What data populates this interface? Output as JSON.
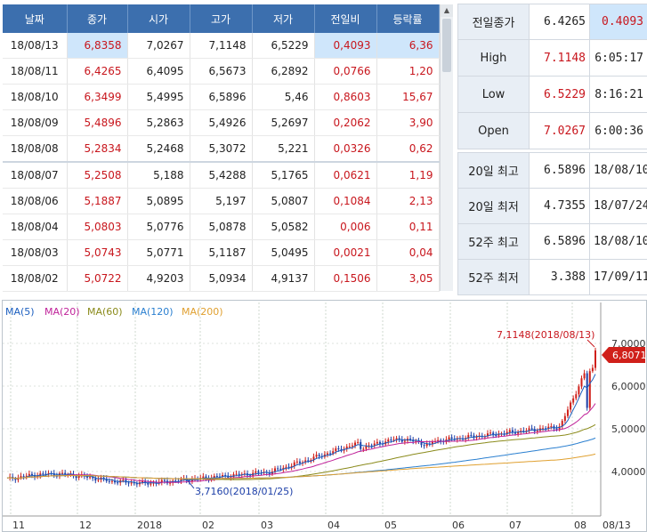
{
  "daily": {
    "columns": [
      "날짜",
      "종가",
      "시가",
      "고가",
      "저가",
      "전일비",
      "등락률"
    ],
    "rows": [
      {
        "date": "18/08/13",
        "close": "6,8358",
        "open": "7,0267",
        "high": "7,1148",
        "low": "6,5229",
        "change": "0,4093",
        "rate": "6,36"
      },
      {
        "date": "18/08/11",
        "close": "6,4265",
        "open": "6,4095",
        "high": "6,5673",
        "low": "6,2892",
        "change": "0,0766",
        "rate": "1,20"
      },
      {
        "date": "18/08/10",
        "close": "6,3499",
        "open": "5,4995",
        "high": "6,5896",
        "low": "5,46",
        "change": "0,8603",
        "rate": "15,67"
      },
      {
        "date": "18/08/09",
        "close": "5,4896",
        "open": "5,2863",
        "high": "5,4926",
        "low": "5,2697",
        "change": "0,2062",
        "rate": "3,90"
      },
      {
        "date": "18/08/08",
        "close": "5,2834",
        "open": "5,2468",
        "high": "5,3072",
        "low": "5,221",
        "change": "0,0326",
        "rate": "0,62"
      },
      {
        "date": "18/08/07",
        "close": "5,2508",
        "open": "5,188",
        "high": "5,4288",
        "low": "5,1765",
        "change": "0,0621",
        "rate": "1,19"
      },
      {
        "date": "18/08/06",
        "close": "5,1887",
        "open": "5,0895",
        "high": "5,197",
        "low": "5,0807",
        "change": "0,1084",
        "rate": "2,13"
      },
      {
        "date": "18/08/04",
        "close": "5,0803",
        "open": "5,0776",
        "high": "5,0878",
        "low": "5,0582",
        "change": "0,006",
        "rate": "0,11"
      },
      {
        "date": "18/08/03",
        "close": "5,0743",
        "open": "5,0771",
        "high": "5,1187",
        "low": "5,0495",
        "change": "0,0021",
        "rate": "0,04"
      },
      {
        "date": "18/08/02",
        "close": "5,0722",
        "open": "4,9203",
        "high": "5,0934",
        "low": "4,9137",
        "change": "0,1506",
        "rate": "3,05"
      }
    ]
  },
  "scrollbar": {
    "up_arrow": "▲"
  },
  "summary": {
    "prev_close": {
      "label": "전일종가",
      "value": "6.4265",
      "change": "0.4093"
    },
    "high": {
      "label": "High",
      "value": "7.1148",
      "time": "6:05:17"
    },
    "low": {
      "label": "Low",
      "value": "6.5229",
      "time": "8:16:21"
    },
    "open": {
      "label": "Open",
      "value": "7.0267",
      "time": "6:00:36"
    }
  },
  "range": [
    {
      "label": "20일 최고",
      "value": "6.5896",
      "date": "18/08/10"
    },
    {
      "label": "20일 최저",
      "value": "4.7355",
      "date": "18/07/24"
    },
    {
      "label": "52주 최고",
      "value": "6.5896",
      "date": "18/08/10"
    },
    {
      "label": "52주 최저",
      "value": "3.388",
      "date": "17/09/11"
    }
  ],
  "chart": {
    "legend": [
      {
        "label": "MA(5)",
        "color": "#1c5fbf"
      },
      {
        "label": "MA(20)",
        "color": "#c0239a"
      },
      {
        "label": "MA(60)",
        "color": "#8a8a1a"
      },
      {
        "label": "MA(120)",
        "color": "#2a7fd0"
      },
      {
        "label": "MA(200)",
        "color": "#e0a030"
      }
    ],
    "max_annotation": "7,1148(2018/08/13)",
    "min_annotation": "3,7160(2018/01/25)",
    "current_price": "6,8071",
    "current_color": "#d0201a",
    "y_ticks": [
      "7,0000",
      "6,0000",
      "5,0000",
      "4,0000"
    ],
    "x_ticks": [
      "11",
      "12",
      "2018",
      "02",
      "03",
      "04",
      "05",
      "06",
      "07",
      "08",
      "08/13"
    ]
  },
  "chart_data": {
    "type": "candlestick",
    "y_ticks": [
      7.0,
      6.0,
      5.0,
      4.0
    ],
    "ylim": [
      3.0,
      7.8
    ],
    "x_ticks": [
      "11",
      "12",
      "2018",
      "02",
      "03",
      "04",
      "05",
      "06",
      "07",
      "08",
      "08/13"
    ],
    "approx_close_by_month": {
      "11": 3.8,
      "12": 3.9,
      "2018": 3.8,
      "02": 3.75,
      "03": 3.8,
      "04": 3.95,
      "05": 4.2,
      "06": 4.6,
      "07": 4.75,
      "08": 4.9,
      "08/13": 6.8358
    },
    "high_point": {
      "value": 7.1148,
      "date": "2018/08/13"
    },
    "low_point": {
      "value": 3.716,
      "date": "2018/01/25"
    },
    "current": 6.8071
  }
}
